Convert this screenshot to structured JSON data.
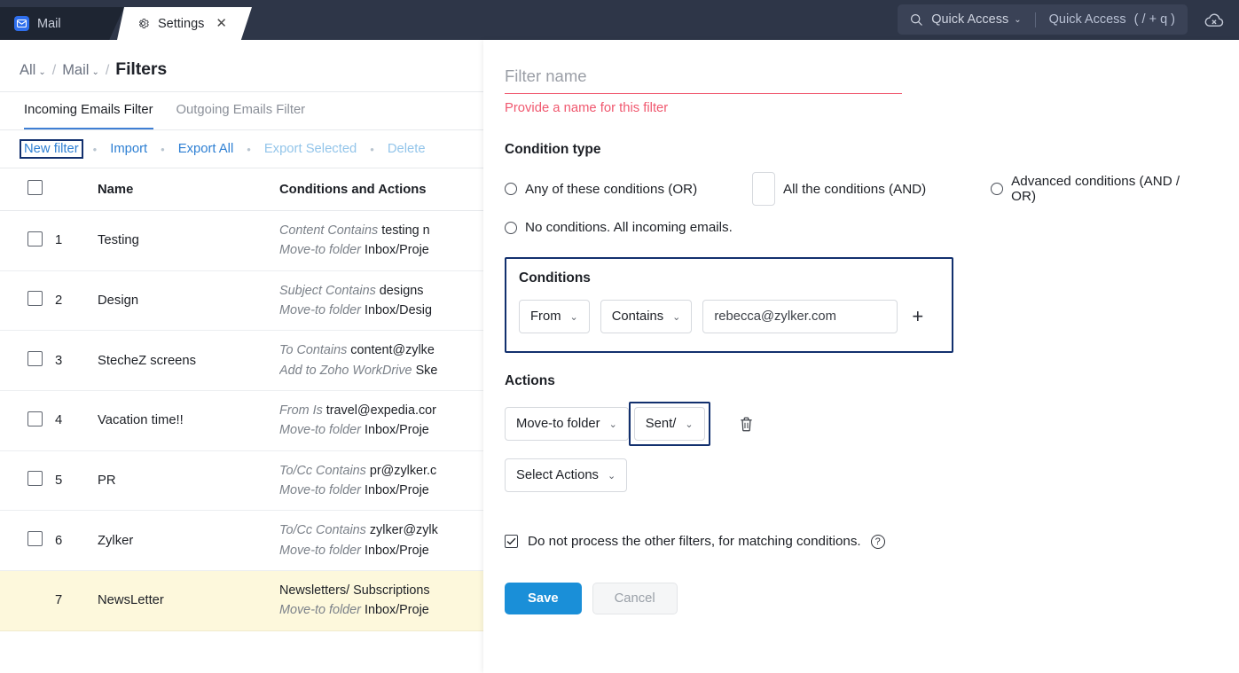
{
  "topbar": {
    "tabs": [
      {
        "label": "Mail",
        "icon": "mail-icon",
        "active": false
      },
      {
        "label": "Settings",
        "icon": "gear-icon",
        "active": true,
        "closable": true
      }
    ],
    "quick_access": {
      "label": "Quick Access",
      "icon": "search-icon",
      "caret": "⌄",
      "hint_label": "Quick Access",
      "hint_keys": "( / + q )"
    },
    "cloud_status_icon": "cloud-offline-icon"
  },
  "breadcrumb": {
    "items": [
      {
        "label": "All",
        "caret": "⌄"
      },
      {
        "label": "Mail",
        "caret": "⌄"
      }
    ],
    "separator": "/",
    "current": "Filters"
  },
  "filter_tabs": [
    {
      "label": "Incoming Emails Filter",
      "active": true
    },
    {
      "label": "Outgoing Emails Filter",
      "active": false
    }
  ],
  "toolbar": {
    "separator": "•",
    "links": [
      {
        "label": "New filter",
        "state": "focused"
      },
      {
        "label": "Import",
        "state": "enabled"
      },
      {
        "label": "Export All",
        "state": "enabled"
      },
      {
        "label": "Export Selected",
        "state": "disabled"
      },
      {
        "label": "Delete",
        "state": "disabled"
      }
    ]
  },
  "table": {
    "headers": {
      "checkbox": "",
      "number": "",
      "name": "Name",
      "conditions": "Conditions and Actions"
    },
    "rows": [
      {
        "no": "1",
        "name": "Testing",
        "checkbox": true,
        "highlight": false,
        "line1_label": "Content Contains",
        "line1_value": "testing n",
        "line2_label": "Move-to folder",
        "line2_value": "Inbox/Proje"
      },
      {
        "no": "2",
        "name": "Design",
        "checkbox": true,
        "highlight": false,
        "line1_label": "Subject Contains",
        "line1_value": "designs",
        "line2_label": "Move-to folder",
        "line2_value": "Inbox/Desig"
      },
      {
        "no": "3",
        "name": "StecheZ screens",
        "checkbox": true,
        "highlight": false,
        "line1_label": "To Contains",
        "line1_value": "content@zylke",
        "line2_label": "Add to Zoho WorkDrive",
        "line2_value": "Ske"
      },
      {
        "no": "4",
        "name": "Vacation time!!",
        "checkbox": true,
        "highlight": false,
        "line1_label": "From Is",
        "line1_value": "travel@expedia.cor",
        "line2_label": "Move-to folder",
        "line2_value": "Inbox/Proje"
      },
      {
        "no": "5",
        "name": "PR",
        "checkbox": true,
        "highlight": false,
        "line1_label": "To/Cc Contains",
        "line1_value": "pr@zylker.c",
        "line2_label": "Move-to folder",
        "line2_value": "Inbox/Proje"
      },
      {
        "no": "6",
        "name": "Zylker",
        "checkbox": true,
        "highlight": false,
        "line1_label": "To/Cc Contains",
        "line1_value": "zylker@zylk",
        "line2_label": "Move-to folder",
        "line2_value": "Inbox/Proje"
      },
      {
        "no": "7",
        "name": "NewsLetter",
        "checkbox": false,
        "highlight": true,
        "line1_label": "",
        "line1_value": "Newsletters/ Subscriptions",
        "line2_label": "Move-to folder",
        "line2_value": "Inbox/Proje"
      }
    ]
  },
  "panel": {
    "name_placeholder": "Filter name",
    "name_value": "",
    "name_error": "Provide a name for this filter",
    "condition_type_title": "Condition type",
    "condition_type_options": [
      {
        "label": "Any of these conditions (OR)",
        "selected": false
      },
      {
        "label": "All the conditions (AND)",
        "selected": true
      },
      {
        "label": "Advanced conditions (AND / OR)",
        "selected": false
      },
      {
        "label": "No conditions. All incoming emails.",
        "selected": false
      }
    ],
    "conditions_title": "Conditions",
    "condition_field": "From",
    "condition_operator": "Contains",
    "condition_value": "rebecca@zylker.com",
    "add_condition_label": "+",
    "actions_title": "Actions",
    "action_type": "Move-to folder",
    "action_target": "Sent/",
    "delete_action_icon": "trash-icon",
    "select_actions_label": "Select Actions",
    "chevron": "⌄",
    "keep_label": "Do not process the other filters, for matching conditions.",
    "keep_checked": true,
    "help_icon_glyph": "?",
    "save_label": "Save",
    "cancel_label": "Cancel"
  },
  "colors": {
    "topbar_bg": "#2e3648",
    "mail_tab_bg": "#1e2532",
    "accent_link": "#2d7fd3",
    "focus_outline": "#12306e",
    "error_red": "#f0586f",
    "save_blue": "#1a8fd8",
    "row_highlight": "#fdf8dc",
    "mail_icon_blue": "#2f6fed"
  }
}
